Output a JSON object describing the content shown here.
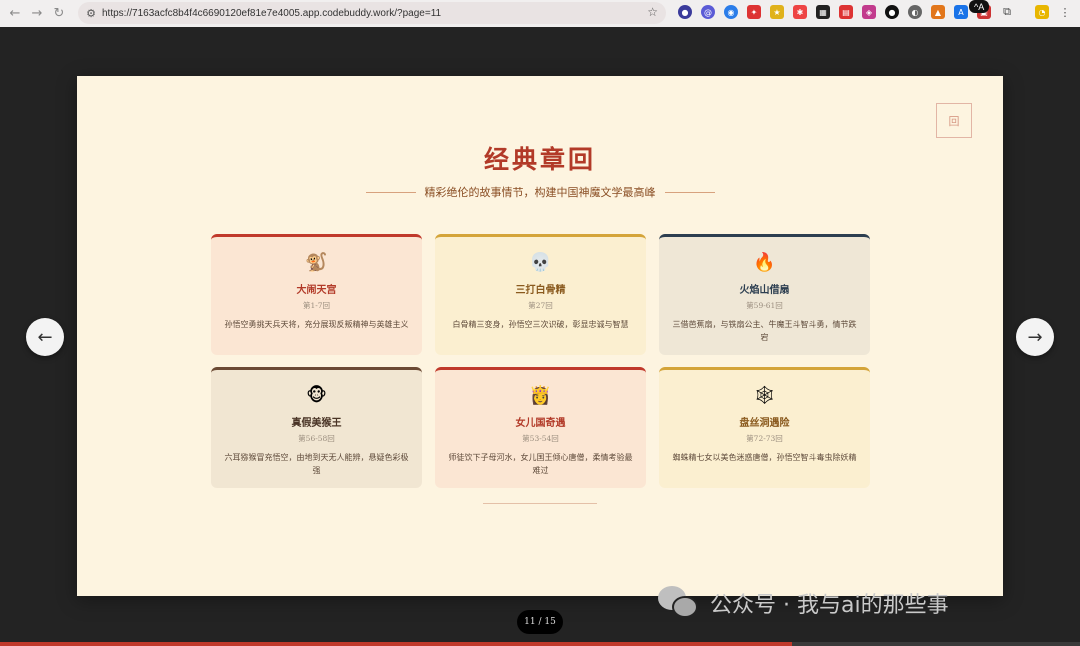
{
  "browser": {
    "url": "https://7163acfc8b4f4c6690120ef81e7e4005.app.codebuddy.work/?page=11",
    "tooltip": "^A"
  },
  "slide": {
    "corner_label": "回",
    "title": "经典章回",
    "subtitle": "精彩绝伦的故事情节，构建中国神魔文学最高峰",
    "cards": [
      {
        "icon": "🐒",
        "name": "大闹天宫",
        "chapters": "第1-7回",
        "desc": "孙悟空勇挑天兵天将，充分展现反叛精神与英雄主义",
        "accent": "#c0392b",
        "bg": "#fbe6d3",
        "title_color": "#b23a28"
      },
      {
        "icon": "💀",
        "name": "三打白骨精",
        "chapters": "第27回",
        "desc": "白骨精三变身，孙悟空三次识破，彰显忠诚与智慧",
        "accent": "#d4a439",
        "bg": "#fbefd0",
        "title_color": "#8a5a1e"
      },
      {
        "icon": "🔥",
        "name": "火焰山借扇",
        "chapters": "第59-61回",
        "desc": "三借芭蕉扇，与铁扇公主、牛魔王斗智斗勇，情节跌宕",
        "accent": "#2c3e50",
        "bg": "#efe7d6",
        "title_color": "#2c3e50"
      },
      {
        "icon": "🐵",
        "name": "真假美猴王",
        "chapters": "第56-58回",
        "desc": "六耳猕猴冒充悟空，由地到天无人能辨，悬疑色彩极强",
        "accent": "#6b4a34",
        "bg": "#f1e6d2",
        "title_color": "#4a3426"
      },
      {
        "icon": "👸",
        "name": "女儿国奇遇",
        "chapters": "第53-54回",
        "desc": "师徒饮下子母河水，女儿国王倾心唐僧，柔情考验最难过",
        "accent": "#c0392b",
        "bg": "#fbe6d3",
        "title_color": "#b23a28"
      },
      {
        "icon": "🕸",
        "name": "盘丝洞遇险",
        "chapters": "第72-73回",
        "desc": "蜘蛛精七女以美色迷惑唐僧，孙悟空智斗毒虫除妖精",
        "accent": "#d4a439",
        "bg": "#fbefd0",
        "title_color": "#8a5a1e"
      }
    ]
  },
  "pager": {
    "text": "11 / 15",
    "current": 11,
    "total": 15
  },
  "watermark": {
    "text": "公众号 · 我与ai的那些事"
  },
  "progress": {
    "fraction": 0.733
  }
}
